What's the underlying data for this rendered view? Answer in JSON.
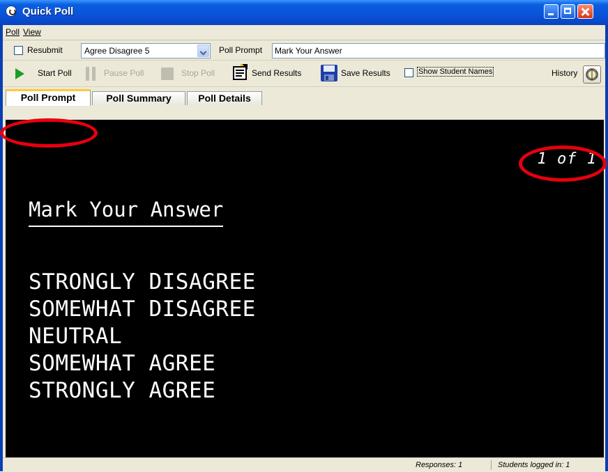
{
  "window": {
    "title": "Quick Poll"
  },
  "menu": {
    "items": [
      "Poll",
      "View"
    ]
  },
  "settings": {
    "resubmit_label": "Resubmit",
    "resubmit_checked": false,
    "poll_type_selected": "Agree Disagree 5",
    "poll_prompt_label": "Poll Prompt",
    "poll_prompt_value": "Mark Your Answer"
  },
  "toolbar": {
    "start_label": "Start Poll",
    "pause_label": "Pause Poll",
    "stop_label": "Stop Poll",
    "send_label": "Send Results",
    "save_label": "Save Results",
    "show_names_label": "Show Student Names",
    "history_label": "History",
    "icons": [
      "play-icon",
      "pause-icon",
      "stop-icon",
      "send-results-icon",
      "floppy-disk-icon",
      "history-icon"
    ]
  },
  "tabs": [
    "Poll Prompt",
    "Poll Summary",
    "Poll Details"
  ],
  "active_tab": "Poll Prompt",
  "prompt_panel": {
    "page_indicator": "1 of 1",
    "title": "Mark Your Answer",
    "choices": [
      "STRONGLY DISAGREE",
      "SOMEWHAT DISAGREE",
      "NEUTRAL",
      "SOMEWHAT AGREE",
      "STRONGLY AGREE"
    ]
  },
  "status": {
    "responses": "Responses: 1",
    "students_logged_in": "Students logged in: 1"
  },
  "colors": {
    "titlebar": "#0a52d8",
    "panel_background": "#000000",
    "annotation_circle": "#e8000d",
    "play_green": "#1c9c2a"
  }
}
